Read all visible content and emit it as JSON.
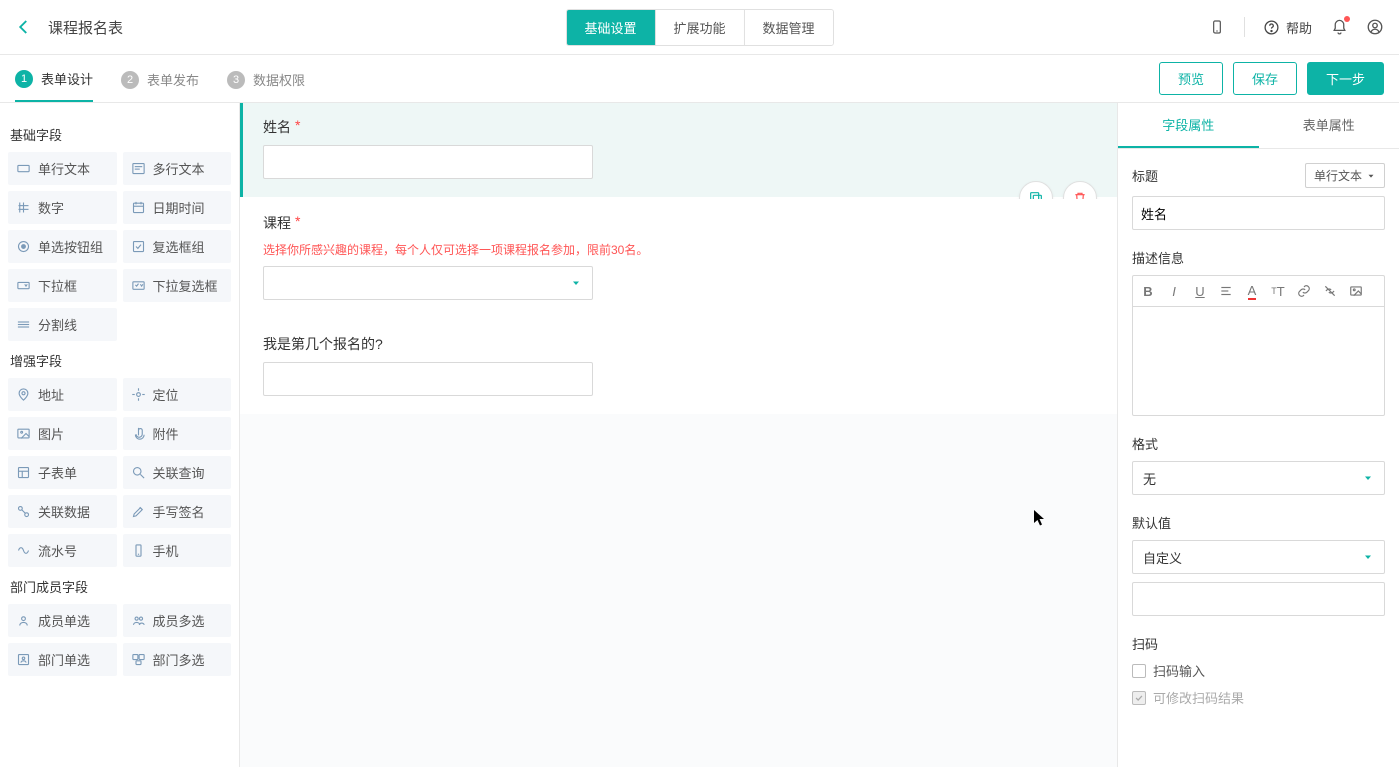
{
  "header": {
    "title": "课程报名表",
    "tabs": [
      "基础设置",
      "扩展功能",
      "数据管理"
    ],
    "help": "帮助"
  },
  "steps": {
    "items": [
      "表单设计",
      "表单发布",
      "数据权限"
    ],
    "actions": {
      "preview": "预览",
      "save": "保存",
      "next": "下一步"
    }
  },
  "sidebar": {
    "groups": [
      {
        "title": "基础字段",
        "items": [
          "单行文本",
          "多行文本",
          "数字",
          "日期时间",
          "单选按钮组",
          "复选框组",
          "下拉框",
          "下拉复选框",
          "分割线"
        ]
      },
      {
        "title": "增强字段",
        "items": [
          "地址",
          "定位",
          "图片",
          "附件",
          "子表单",
          "关联查询",
          "关联数据",
          "手写签名",
          "流水号",
          "手机"
        ]
      },
      {
        "title": "部门成员字段",
        "items": [
          "成员单选",
          "成员多选",
          "部门单选",
          "部门多选"
        ]
      }
    ]
  },
  "canvas": {
    "fields": [
      {
        "label": "姓名",
        "required": true,
        "desc": "",
        "type": "text",
        "selected": true
      },
      {
        "label": "课程",
        "required": true,
        "desc": "选择你所感兴趣的课程，每个人仅可选择一项课程报名参加，限前30名。",
        "type": "select",
        "selected": false
      },
      {
        "label": "我是第几个报名的?",
        "required": false,
        "desc": "",
        "type": "text",
        "selected": false
      }
    ]
  },
  "props": {
    "tabs": [
      "字段属性",
      "表单属性"
    ],
    "title_label": "标题",
    "type_tag": "单行文本",
    "title_value": "姓名",
    "desc_label": "描述信息",
    "format_label": "格式",
    "format_value": "无",
    "default_label": "默认值",
    "default_value": "自定义",
    "scan_label": "扫码",
    "scan_input": "扫码输入",
    "scan_editable": "可修改扫码结果"
  }
}
